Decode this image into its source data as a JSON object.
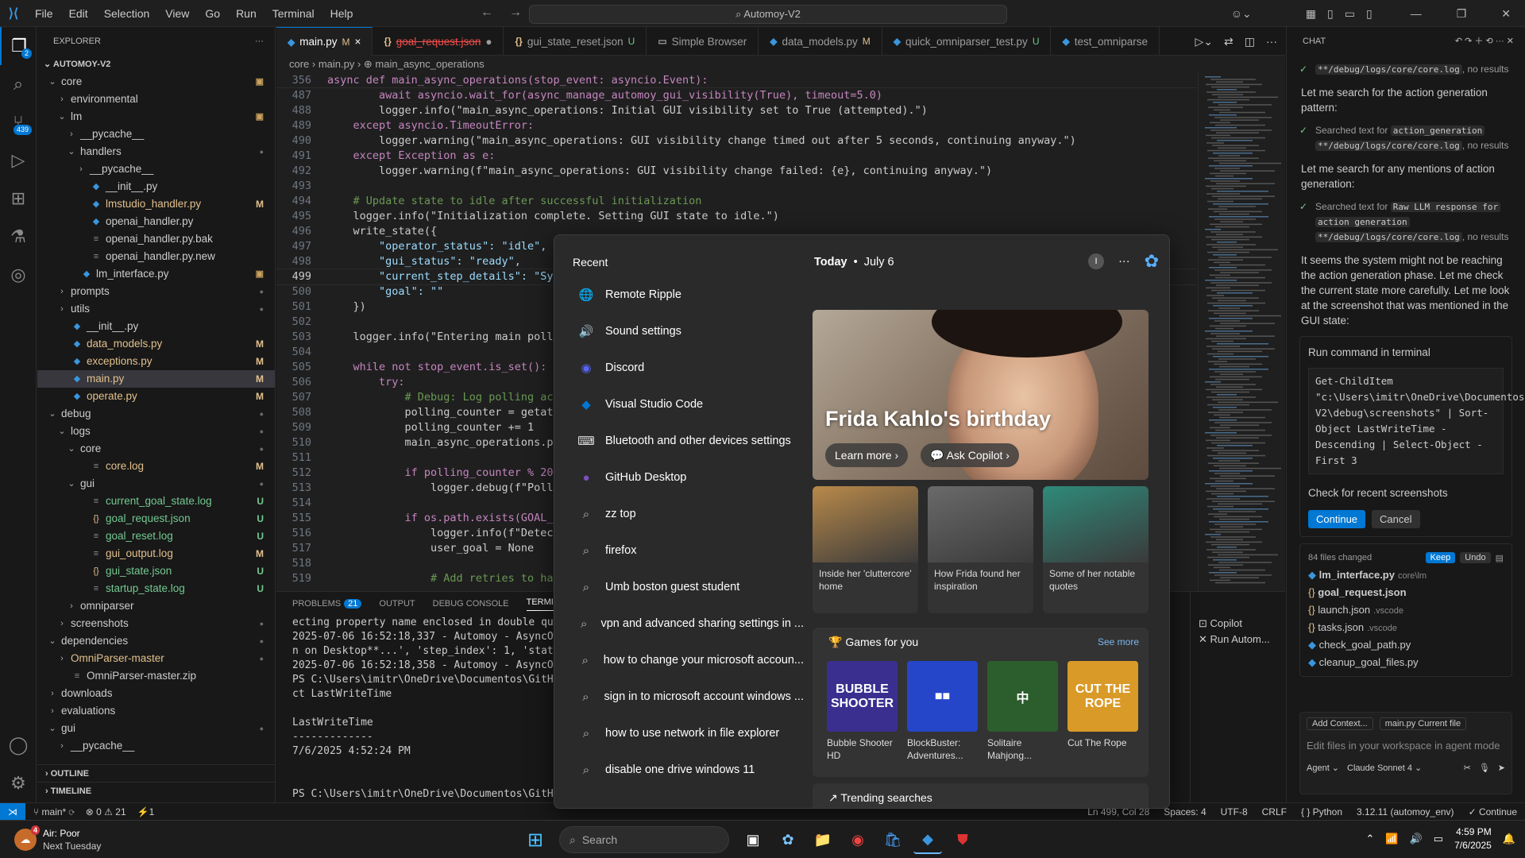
{
  "titlebar": {
    "menus": [
      "File",
      "Edit",
      "Selection",
      "View",
      "Go",
      "Run",
      "Terminal",
      "Help"
    ],
    "search": "Automoy-V2"
  },
  "activity": {
    "explorer_badge": "2",
    "scm_badge": "439"
  },
  "explorer": {
    "header": "EXPLORER",
    "project": "AUTOMOY-V2",
    "rows": [
      {
        "d": 0,
        "t": "folder-open",
        "label": "core",
        "st": "dot-box"
      },
      {
        "d": 1,
        "t": "folder",
        "label": "environmental",
        "st": ""
      },
      {
        "d": 1,
        "t": "folder-open",
        "label": "lm",
        "st": "dot-box"
      },
      {
        "d": 2,
        "t": "folder",
        "label": "__pycache__",
        "st": ""
      },
      {
        "d": 2,
        "t": "folder-open",
        "label": "handlers",
        "st": "dot"
      },
      {
        "d": 3,
        "t": "folder",
        "label": "__pycache__",
        "st": ""
      },
      {
        "d": 3,
        "t": "py",
        "label": "__init__.py",
        "st": ""
      },
      {
        "d": 3,
        "t": "py",
        "label": "lmstudio_handler.py",
        "st": "M"
      },
      {
        "d": 3,
        "t": "py",
        "label": "openai_handler.py",
        "st": ""
      },
      {
        "d": 3,
        "t": "file",
        "label": "openai_handler.py.bak",
        "st": ""
      },
      {
        "d": 3,
        "t": "file",
        "label": "openai_handler.py.new",
        "st": ""
      },
      {
        "d": 2,
        "t": "py",
        "label": "lm_interface.py",
        "st": "dot-box"
      },
      {
        "d": 1,
        "t": "folder",
        "label": "prompts",
        "st": "dot"
      },
      {
        "d": 1,
        "t": "folder",
        "label": "utils",
        "st": "dot"
      },
      {
        "d": 1,
        "t": "py",
        "label": "__init__.py",
        "st": ""
      },
      {
        "d": 1,
        "t": "py",
        "label": "data_models.py",
        "st": "M"
      },
      {
        "d": 1,
        "t": "py",
        "label": "exceptions.py",
        "st": "M"
      },
      {
        "d": 1,
        "t": "py",
        "label": "main.py",
        "st": "M",
        "sel": true
      },
      {
        "d": 1,
        "t": "py",
        "label": "operate.py",
        "st": "M"
      },
      {
        "d": 0,
        "t": "folder-open",
        "label": "debug",
        "st": "dot"
      },
      {
        "d": 1,
        "t": "folder-open",
        "label": "logs",
        "st": "dot"
      },
      {
        "d": 2,
        "t": "folder-open",
        "label": "core",
        "st": "dot"
      },
      {
        "d": 3,
        "t": "file",
        "label": "core.log",
        "st": "M"
      },
      {
        "d": 2,
        "t": "folder-open",
        "label": "gui",
        "st": "dot"
      },
      {
        "d": 3,
        "t": "file",
        "label": "current_goal_state.log",
        "st": "U"
      },
      {
        "d": 3,
        "t": "json",
        "label": "goal_request.json",
        "st": "U"
      },
      {
        "d": 3,
        "t": "file",
        "label": "goal_reset.log",
        "st": "U"
      },
      {
        "d": 3,
        "t": "file",
        "label": "gui_output.log",
        "st": "M"
      },
      {
        "d": 3,
        "t": "json",
        "label": "gui_state.json",
        "st": "U"
      },
      {
        "d": 3,
        "t": "file",
        "label": "startup_state.log",
        "st": "U"
      },
      {
        "d": 2,
        "t": "folder",
        "label": "omniparser",
        "st": ""
      },
      {
        "d": 1,
        "t": "folder",
        "label": "screenshots",
        "st": "dot"
      },
      {
        "d": 0,
        "t": "folder-open",
        "label": "dependencies",
        "st": "dot"
      },
      {
        "d": 1,
        "t": "folder",
        "label": "OmniParser-master",
        "st": "dot",
        "color": "c-yel"
      },
      {
        "d": 1,
        "t": "file",
        "label": "OmniParser-master.zip",
        "st": ""
      },
      {
        "d": 0,
        "t": "folder",
        "label": "downloads",
        "st": ""
      },
      {
        "d": 0,
        "t": "folder",
        "label": "evaluations",
        "st": ""
      },
      {
        "d": 0,
        "t": "folder-open",
        "label": "gui",
        "st": "dot"
      },
      {
        "d": 1,
        "t": "folder",
        "label": "__pycache__",
        "st": ""
      }
    ],
    "outline": "OUTLINE",
    "timeline": "TIMELINE"
  },
  "tabs": [
    {
      "label": "main.py",
      "icon": "py",
      "mod": "M",
      "active": true,
      "close": "×"
    },
    {
      "label": "goal_request.json",
      "icon": "json",
      "mod": "",
      "active": false,
      "close": "●"
    },
    {
      "label": "gui_state_reset.json",
      "icon": "json",
      "mod": "U",
      "active": false,
      "close": ""
    },
    {
      "label": "Simple Browser",
      "icon": "browser",
      "mod": "",
      "active": false,
      "close": ""
    },
    {
      "label": "data_models.py",
      "icon": "py",
      "mod": "M",
      "active": false,
      "close": ""
    },
    {
      "label": "quick_omniparser_test.py",
      "icon": "py",
      "mod": "U",
      "active": false,
      "close": ""
    },
    {
      "label": "test_omniparse",
      "icon": "py",
      "mod": "",
      "active": false,
      "close": ""
    }
  ],
  "breadcrumb": "core  ›  main.py  ›  ⊕ main_async_operations",
  "code": [
    {
      "n": "356",
      "t": "async def main_async_operations(stop_event: asyncio.Event):"
    },
    {
      "n": "487",
      "t": "        await asyncio.wait_for(async_manage_automoy_gui_visibility(True), timeout=5.0)"
    },
    {
      "n": "488",
      "t": "        logger.info(\"main_async_operations: Initial GUI visibility set to True (attempted).\")"
    },
    {
      "n": "489",
      "t": "    except asyncio.TimeoutError:"
    },
    {
      "n": "490",
      "t": "        logger.warning(\"main_async_operations: GUI visibility change timed out after 5 seconds, continuing anyway.\")"
    },
    {
      "n": "491",
      "t": "    except Exception as e:"
    },
    {
      "n": "492",
      "t": "        logger.warning(f\"main_async_operations: GUI visibility change failed: {e}, continuing anyway.\")"
    },
    {
      "n": "493",
      "t": ""
    },
    {
      "n": "494",
      "t": "    # Update state to idle after successful initialization"
    },
    {
      "n": "495",
      "t": "    logger.info(\"Initialization complete. Setting GUI state to idle.\")"
    },
    {
      "n": "496",
      "t": "    write_state({"
    },
    {
      "n": "497",
      "t": "        \"operator_status\": \"idle\","
    },
    {
      "n": "498",
      "t": "        \"gui_status\": \"ready\","
    },
    {
      "n": "499",
      "t": "        \"current_step_details\": \"Syst"
    },
    {
      "n": "500",
      "t": "        \"goal\": \"\""
    },
    {
      "n": "501",
      "t": "    })"
    },
    {
      "n": "502",
      "t": ""
    },
    {
      "n": "503",
      "t": "    logger.info(\"Entering main pollin"
    },
    {
      "n": "504",
      "t": ""
    },
    {
      "n": "505",
      "t": "    while not stop_event.is_set():"
    },
    {
      "n": "506",
      "t": "        try:"
    },
    {
      "n": "507",
      "t": "            # Debug: Log polling acti"
    },
    {
      "n": "508",
      "t": "            polling_counter = getattr"
    },
    {
      "n": "509",
      "t": "            polling_counter += 1"
    },
    {
      "n": "510",
      "t": "            main_async_operations.pol"
    },
    {
      "n": "511",
      "t": ""
    },
    {
      "n": "512",
      "t": "            if polling_counter % 20 ="
    },
    {
      "n": "513",
      "t": "                logger.debug(f\"Pollin"
    },
    {
      "n": "514",
      "t": ""
    },
    {
      "n": "515",
      "t": "            if os.path.exists(GOAL_RE"
    },
    {
      "n": "516",
      "t": "                logger.info(f\"Detecte"
    },
    {
      "n": "517",
      "t": "                user_goal = None"
    },
    {
      "n": "518",
      "t": ""
    },
    {
      "n": "519",
      "t": "                # Add retries to hand"
    }
  ],
  "current_line": "499",
  "panel": {
    "tabs": [
      "PROBLEMS",
      "OUTPUT",
      "DEBUG CONSOLE",
      "TERMINAL"
    ],
    "problems_count": "21",
    "terminal": [
      "ecting property name enclosed in double quotes:",
      "2025-07-06 16:52:18,337 - Automoy - AsyncOpsThr",
      "n on Desktop**...', 'step_index': 1, 'status':",
      "2025-07-06 16:52:18,358 - Automoy - AsyncOpsThr",
      "PS C:\\Users\\imitr\\OneDrive\\Documentos\\GitHub\\Au",
      "ct LastWriteTime",
      "",
      "LastWriteTime",
      "-------------",
      "7/6/2025 4:52:24 PM",
      "",
      "",
      "PS C:\\Users\\imitr\\OneDrive\\Documentos\\GitHub\\Au"
    ],
    "term_side": [
      "Copilot",
      "Run Autom..."
    ]
  },
  "chat": {
    "header": "CHAT",
    "items": [
      {
        "type": "note",
        "pre": "",
        "chip": "**/debug/logs/core/core.log",
        "post": ", no results"
      },
      {
        "type": "msg",
        "text": "Let me search for the action generation pattern:"
      },
      {
        "type": "note",
        "pre": "Searched text for ",
        "chip": "action_generation",
        "post": ""
      },
      {
        "type": "note2",
        "pre": "",
        "chip": "**/debug/logs/core/core.log",
        "post": ", no results"
      },
      {
        "type": "msg",
        "text": "Let me search for any mentions of action generation:"
      },
      {
        "type": "note",
        "pre": "Searched text for ",
        "chip": "Raw LLM response for",
        "post": ""
      },
      {
        "type": "note2",
        "pre": "",
        "chip": "action generation",
        "post": ""
      },
      {
        "type": "note2",
        "pre": "",
        "chip": "**/debug/logs/core/core.log",
        "post": ", no results"
      },
      {
        "type": "msg",
        "text": "It seems the system might not be reaching the action generation phase. Let me check the current state more carefully. Let me look at the screenshot that was mentioned in the GUI state:"
      }
    ],
    "run_title": "Run command in terminal",
    "run_cmd": "Get-ChildItem \"c:\\Users\\imitr\\OneDrive\\Documentos\\GitHub\\Automoy-V2\\debug\\screenshots\" | Sort-Object LastWriteTime -Descending | Select-Object -First 3",
    "run_desc": "Check for recent screenshots",
    "continue": "Continue",
    "cancel": "Cancel",
    "changed": "84 files changed",
    "keep": "Keep",
    "undo": "Undo",
    "files": [
      {
        "icon": "py",
        "name": "lm_interface.py",
        "path": "core\\lm"
      },
      {
        "icon": "json",
        "name": "goal_request.json",
        "path": ""
      },
      {
        "icon": "json",
        "name": "launch.json",
        "path": ".vscode"
      },
      {
        "icon": "json",
        "name": "tasks.json",
        "path": ".vscode"
      },
      {
        "icon": "py",
        "name": "check_goal_path.py",
        "path": ""
      },
      {
        "icon": "py",
        "name": "cleanup_goal_files.py",
        "path": ""
      }
    ],
    "add_context": "Add Context...",
    "current_file": "main.py  Current file",
    "placeholder": "Edit files in your workspace in agent mode",
    "mode": "Agent ⌄",
    "model": "Claude Sonnet 4 ⌄"
  },
  "status": {
    "branch": "main*",
    "errors": "⊗ 0 ⚠ 21",
    "ports": "⚡1",
    "right": [
      "Ln 499, Col 28",
      "Spaces: 4",
      "UTF-8",
      "CRLF",
      "{ } Python",
      "3.12.11 (automoy_env)",
      "✓ Continue"
    ]
  },
  "start": {
    "recent_title": "Recent",
    "recent": [
      {
        "icon": "🌐",
        "label": "Remote Ripple",
        "color": "#3a96dd"
      },
      {
        "icon": "🔊",
        "label": "Sound settings",
        "color": "#555"
      },
      {
        "icon": "◉",
        "label": "Discord",
        "color": "#5865f2"
      },
      {
        "icon": "◆",
        "label": "Visual Studio Code",
        "color": "#0078d4"
      },
      {
        "icon": "⌨",
        "label": "Bluetooth and other devices settings",
        "color": "#555"
      },
      {
        "icon": "●",
        "label": "GitHub Desktop",
        "color": "#7b4fbf"
      },
      {
        "icon": "⌕",
        "label": "zz top",
        "color": ""
      },
      {
        "icon": "⌕",
        "label": "firefox",
        "color": ""
      },
      {
        "icon": "⌕",
        "label": "Umb boston guest student",
        "color": ""
      },
      {
        "icon": "⌕",
        "label": "vpn and advanced sharing settings in ...",
        "color": ""
      },
      {
        "icon": "⌕",
        "label": "how to change your microsoft accoun...",
        "color": ""
      },
      {
        "icon": "⌕",
        "label": "sign in to microsoft account windows ...",
        "color": ""
      },
      {
        "icon": "⌕",
        "label": "how to use network in file explorer",
        "color": ""
      },
      {
        "icon": "⌕",
        "label": "disable one drive windows 11",
        "color": ""
      }
    ],
    "today": "Today",
    "date": "July 6",
    "user_initial": "I",
    "hero_title": "Frida Kahlo's birthday",
    "learn_more": "Learn more ›",
    "ask_copilot": "Ask Copilot ›",
    "cards": [
      {
        "caption": "Inside her 'cluttercore' home",
        "bg": "#b8894a"
      },
      {
        "caption": "How Frida found her inspiration",
        "bg": "#6a6a6a"
      },
      {
        "caption": "Some of her notable quotes",
        "bg": "#2f8a7a"
      }
    ],
    "games_title": "Games for you",
    "see_more": "See more",
    "games": [
      {
        "art": "BUBBLE SHOOTER",
        "name": "Bubble Shooter HD",
        "bg": "#3a2f8f"
      },
      {
        "art": "■■",
        "name": "BlockBuster: Adventures...",
        "bg": "#2546c9"
      },
      {
        "art": "中",
        "name": "Solitaire Mahjong...",
        "bg": "#2c5d2c"
      },
      {
        "art": "CUT THE ROPE",
        "name": "Cut The Rope",
        "bg": "#d99a28"
      }
    ],
    "trending": "Trending searches"
  },
  "taskbar": {
    "weather_badge": "4",
    "weather_title": "Air: Poor",
    "weather_sub": "Next Tuesday",
    "search": "Search",
    "time": "4:59 PM",
    "date": "7/6/2025"
  }
}
